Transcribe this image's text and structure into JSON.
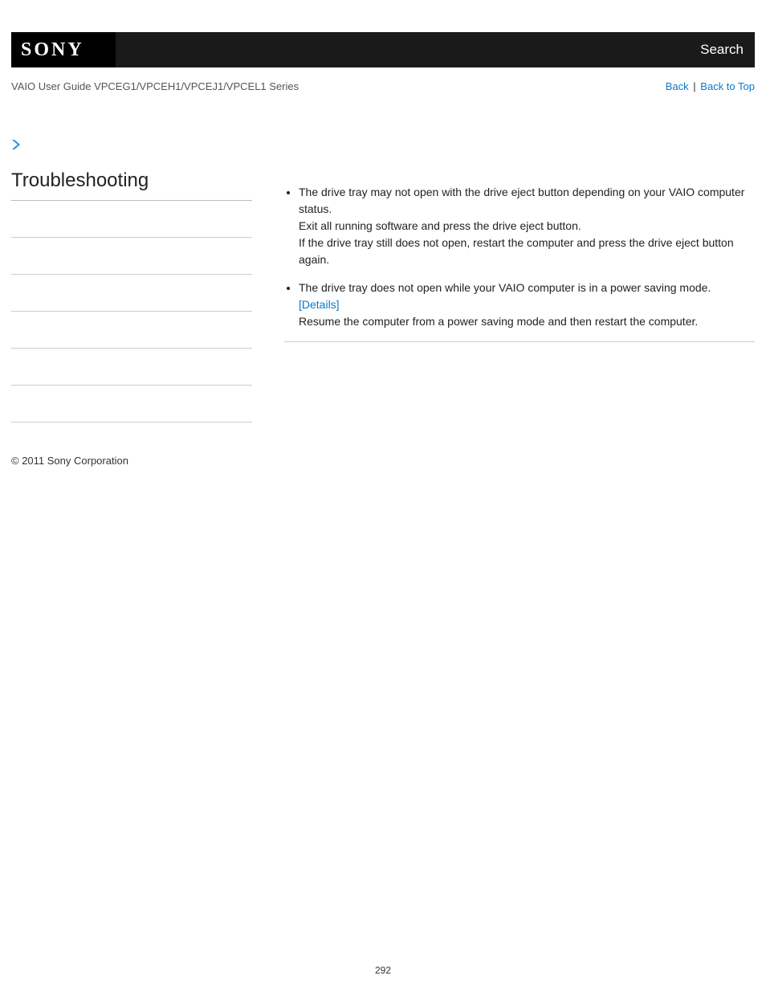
{
  "header": {
    "logo_text": "SONY",
    "search_label": "Search"
  },
  "subheader": {
    "guide_title": "VAIO User Guide VPCEG1/VPCEH1/VPCEJ1/VPCEL1 Series",
    "back_label": "Back",
    "back_to_top_label": "Back to Top"
  },
  "sidebar": {
    "heading": "Troubleshooting"
  },
  "main": {
    "items": [
      {
        "line1": "The drive tray may not open with the drive eject button depending on your VAIO computer status.",
        "line2": "Exit all running software and press the drive eject button.",
        "line3": "If the drive tray still does not open, restart the computer and press the drive eject button again."
      },
      {
        "line1": "The drive tray does not open while your VAIO computer is in a power saving mode.",
        "details_label": "[Details]",
        "line2": "Resume the computer from a power saving mode and then restart the computer."
      }
    ]
  },
  "footer": {
    "copyright": "© 2011 Sony Corporation",
    "page_number": "292"
  }
}
